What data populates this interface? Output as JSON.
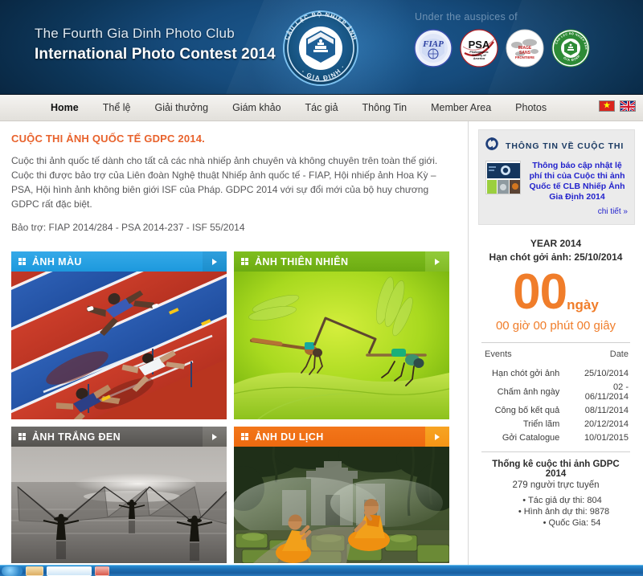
{
  "header": {
    "title_line1": "The Fourth Gia Dinh Photo Club",
    "title_line2": "International Photo Contest 2014",
    "auspices_label": "Under the auspices of",
    "logo_text_top": "CÂU LẠC BỘ NHIẾP ẢNH",
    "logo_text_bottom": "GIA ĐỊNH",
    "sponsors": [
      {
        "name": "fiap-logo",
        "label": "FIAP"
      },
      {
        "name": "psa-logo",
        "label": "PSA",
        "sub1": "Photographic",
        "sub2": "Society of",
        "sub3": "America"
      },
      {
        "name": "isf-logo",
        "label": "ISF"
      },
      {
        "name": "gdpc-green-logo",
        "label": "CÂU LẠC BỘ NHIẾP ẢNH GIA ĐỊNH"
      }
    ]
  },
  "nav": {
    "items": [
      {
        "label": "Home",
        "active": true
      },
      {
        "label": "Thể lệ",
        "active": false
      },
      {
        "label": "Giải thưởng",
        "active": false
      },
      {
        "label": "Giám khảo",
        "active": false
      },
      {
        "label": "Tác giả",
        "active": false
      },
      {
        "label": "Thông Tin",
        "active": false
      },
      {
        "label": "Member Area",
        "active": false
      },
      {
        "label": "Photos",
        "active": false
      }
    ],
    "flags": [
      {
        "name": "flag-vietnam",
        "code": "vn"
      },
      {
        "name": "flag-uk",
        "code": "uk"
      }
    ]
  },
  "intro": {
    "heading": "CUỘC THI ẢNH QUỐC TẾ GDPC 2014.",
    "paragraph": "Cuộc thi ảnh quốc tế dành cho tất cả các nhà nhiếp ảnh chuyên và không chuyên trên toàn thế giới. Cuộc thi được bảo trợ của Liên đoàn Nghệ thuật Nhiếp ảnh quốc tế - FIAP, Hội nhiếp ảnh Hoa Kỳ – PSA, Hội hình ảnh không biên giới ISF của Pháp. GDPC 2014 với sự đổi mới của bộ huy chương GDPC rất đặc biệt.",
    "sponsorship": "Bảo trợ: FIAP 2014/284 - PSA 2014-237 - ISF 55/2014"
  },
  "categories": [
    {
      "label": "ẢNH MÀU",
      "theme": "blue",
      "photo": "hurdles-race"
    },
    {
      "label": "ẢNH THIÊN NHIÊN",
      "theme": "green",
      "photo": "damselflies-on-leaf"
    },
    {
      "label": "ẢNH TRẮNG ĐEN",
      "theme": "gray",
      "photo": "fishermen-with-nets-bw"
    },
    {
      "label": "ẢNH DU LỊCH",
      "theme": "orange",
      "photo": "monks-at-temple-ruins"
    }
  ],
  "sidebar": {
    "info_box": {
      "title": "THÔNG TIN VỀ CUỘC THI",
      "news_title": "Thông báo cập nhật lệ phí thi của Cuộc thi ảnh Quốc tế CLB Nhiếp Ảnh Gia Định 2014",
      "more_label": "chi tiết »"
    },
    "countdown": {
      "year_label": "YEAR 2014",
      "deadline_label": "Hạn chót gởi ảnh: 25/10/2014",
      "days": "00",
      "days_unit": "ngày",
      "hms": "00 giờ 00 phút 00 giây"
    },
    "events": {
      "col_event": "Events",
      "col_date": "Date",
      "rows": [
        {
          "event": "Hạn chót gởi ảnh",
          "date": "25/10/2014"
        },
        {
          "event": "Chấm ảnh ngày",
          "date": "02 - 06/11/2014"
        },
        {
          "event": "Công bố kết quả",
          "date": "08/11/2014"
        },
        {
          "event": "Triển lãm",
          "date": "20/12/2014"
        },
        {
          "event": "Gởi Catalogue",
          "date": "10/01/2015"
        }
      ]
    },
    "stats": {
      "title": "Thống kê cuộc thi ảnh GDPC 2014",
      "online": "279 người trực tuyến",
      "items": [
        "Tác giả dự thi: 804",
        "Hình ảnh dự thi: 9878",
        "Quốc Gia: 54"
      ]
    }
  },
  "colors": {
    "accent_orange": "#e8622c",
    "countdown_orange": "#f07d2a",
    "header_blue": "#0d3659",
    "cat_blue": "#1d99dd",
    "cat_green": "#7fbe1e",
    "cat_gray": "#55534f",
    "cat_orange": "#ec6a10",
    "link_blue": "#2222cc"
  }
}
